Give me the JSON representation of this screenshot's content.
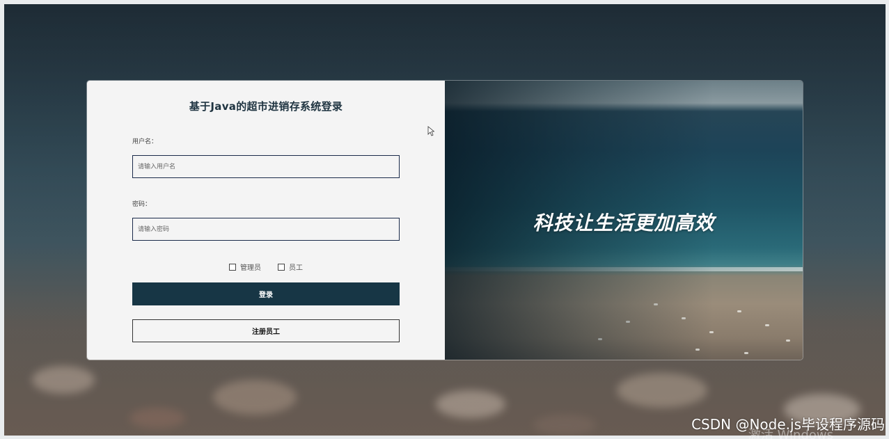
{
  "form": {
    "title": "基于Java的超市进销存系统登录",
    "username_label": "用户名：",
    "username_placeholder": "请输入用户名",
    "username_value": "",
    "password_label": "密码：",
    "password_placeholder": "请输入密码",
    "password_value": "",
    "roles": [
      {
        "label": "管理员",
        "checked": false
      },
      {
        "label": "员工",
        "checked": false
      }
    ],
    "login_label": "登录",
    "register_label": "注册员工"
  },
  "banner": {
    "slogan": "科技让生活更加高效"
  },
  "watermark": {
    "text": "CSDN @Node.js毕设程序源码",
    "faint_text": "激活 Windows"
  },
  "colors": {
    "accent": "#173645",
    "input_border": "#1a2a4a",
    "panel_bg": "#f4f4f4"
  }
}
